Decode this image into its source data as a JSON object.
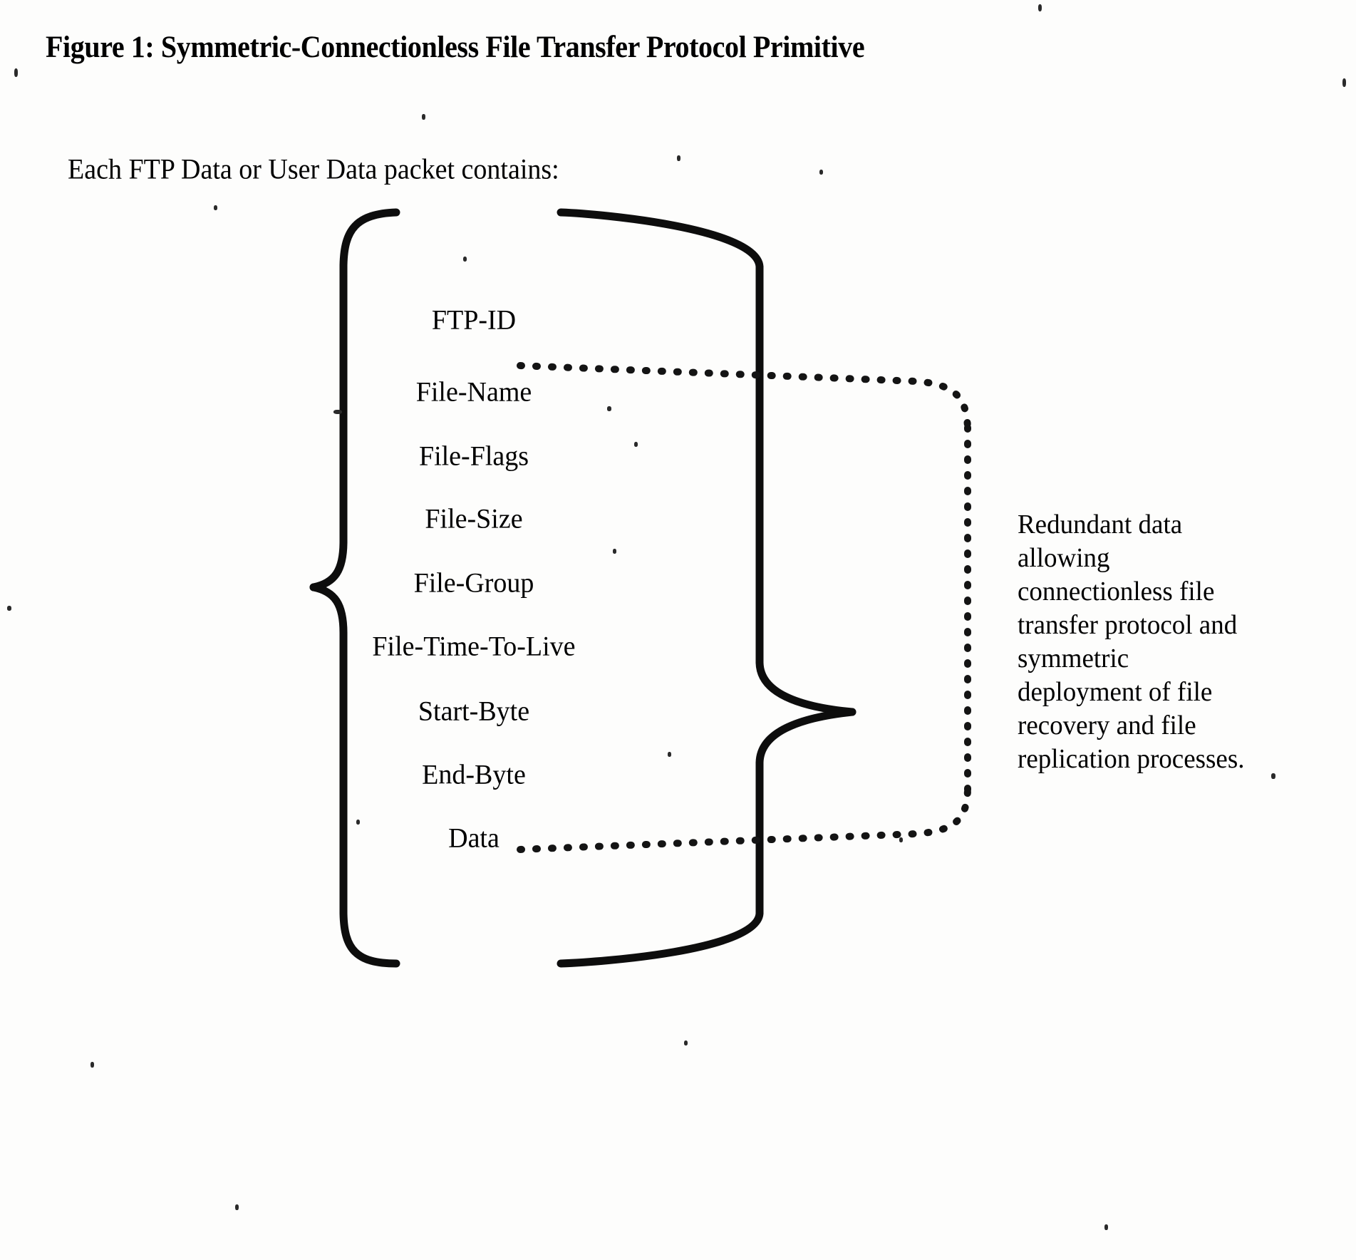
{
  "document": {
    "title": "Figure 1: Symmetric-Connectionless File Transfer Protocol Primitive",
    "intro": "Each FTP Data or User Data packet contains:"
  },
  "packet": {
    "fields": [
      {
        "label": "FTP-ID"
      },
      {
        "label": "File-Name"
      },
      {
        "label": "File-Flags"
      },
      {
        "label": "File-Size"
      },
      {
        "label": "File-Group"
      },
      {
        "label": "File-Time-To-Live"
      },
      {
        "label": "Start-Byte"
      },
      {
        "label": "End-Byte"
      },
      {
        "label": "Data"
      }
    ]
  },
  "annotation": {
    "full_text": "Redundant data allowing connectionless file transfer protocol and symmetric deployment of file recovery and file replication processes.",
    "lines": [
      "Redundant data",
      "allowing",
      "connectionless file",
      "transfer protocol and",
      "symmetric",
      "deployment of file",
      "recovery and file",
      "replication processes."
    ]
  },
  "style": {
    "ink": "#101010",
    "paper": "#fdfdfc"
  }
}
